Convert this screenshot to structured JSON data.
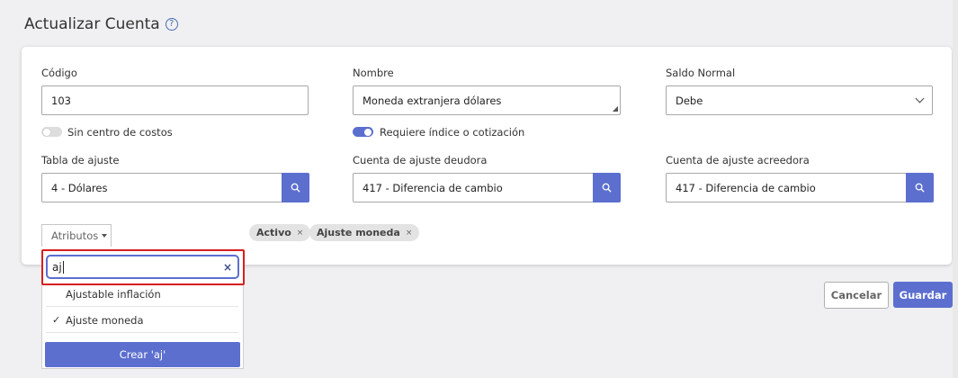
{
  "page": {
    "title": "Actualizar Cuenta",
    "help_glyph": "?"
  },
  "form": {
    "codigo": {
      "label": "Código",
      "value": "103"
    },
    "nombre": {
      "label": "Nombre",
      "value": "Moneda extranjera dólares"
    },
    "saldo_normal": {
      "label": "Saldo Normal",
      "value": "Debe"
    },
    "sin_centro_costos": {
      "label": "Sin centro de costos",
      "on": false
    },
    "requiere_indice": {
      "label": "Requiere índice o cotización",
      "on": true
    },
    "tabla_ajuste": {
      "label": "Tabla de ajuste",
      "value": "4 - Dólares"
    },
    "cuenta_deudora": {
      "label": "Cuenta de ajuste deudora",
      "value": "417 - Diferencia de cambio"
    },
    "cuenta_acreedora": {
      "label": "Cuenta de ajuste acreedora",
      "value": "417 - Diferencia de cambio"
    }
  },
  "atributos": {
    "label": "Atributos",
    "tags": [
      {
        "label": "Activo",
        "close": "×"
      },
      {
        "label": "Ajuste moneda",
        "close": "×"
      }
    ],
    "dropdown": {
      "search_value": "aj",
      "clear_glyph": "×",
      "options": [
        {
          "label": "Ajustable inflación",
          "selected": false
        },
        {
          "label": "Ajuste moneda",
          "selected": true,
          "check": "✓"
        }
      ],
      "create_label": "Crear 'aj'"
    }
  },
  "actions": {
    "cancel_label": "Cancelar",
    "save_label": "Guardar"
  },
  "colors": {
    "accent": "#5c6fcf",
    "highlight": "#d81e1e"
  }
}
